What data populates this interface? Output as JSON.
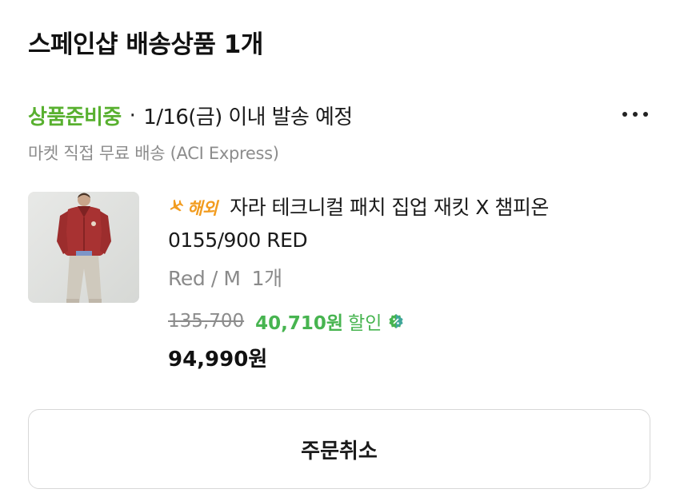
{
  "header": {
    "title": "스페인샵 배송상품 1개"
  },
  "order": {
    "status": "상품준비중",
    "separator": "·",
    "ship_date": "1/16(금) 이내 발송 예정",
    "shipping_method": "마켓 직접 무료 배송 (ACI Express)"
  },
  "product": {
    "overseas_badge": "해외",
    "name": "자라 테크니컬 패치 집업 재킷 X 챔피온 0155/900 RED",
    "option": "Red / M",
    "quantity": "1개",
    "original_price": "135,700",
    "discount_amount": "40,710원",
    "discount_label": "할인",
    "final_price": "94,990원"
  },
  "actions": {
    "cancel_label": "주문취소"
  },
  "colors": {
    "status_green": "#58b02f",
    "discount_green": "#47b450",
    "overseas_orange": "#f29c1f"
  },
  "icons": {
    "more": "more-dots-icon",
    "overseas": "airplane-icon",
    "discount": "discount-tag-icon"
  }
}
